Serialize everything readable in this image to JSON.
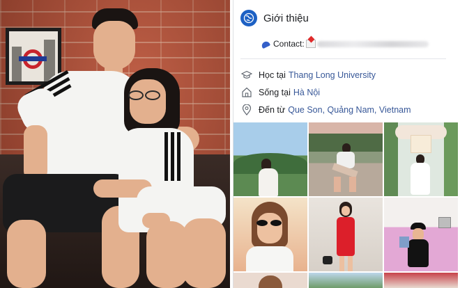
{
  "intro": {
    "title": "Giới thiệu",
    "contact_label": "Contact:",
    "rows": [
      {
        "prefix": "Học tại",
        "link": "Thang Long University",
        "icon": "graduation-cap-icon"
      },
      {
        "prefix": "Sống tại",
        "link": "Hà Nội",
        "icon": "home-icon"
      },
      {
        "prefix": "Đến từ",
        "link": "Que Son, Quảng Nam, Vietnam",
        "icon": "location-pin-icon"
      }
    ]
  },
  "colors": {
    "link": "#385898",
    "globe": "#1d61c4",
    "text": "#1c1e21"
  },
  "photos": [
    "photo-girl-hills",
    "photo-girl-rooftop",
    "photo-girl-flower-arch",
    "photo-girl-sunglasses",
    "photo-girl-red-dress",
    "photo-girl-pink-wall"
  ]
}
